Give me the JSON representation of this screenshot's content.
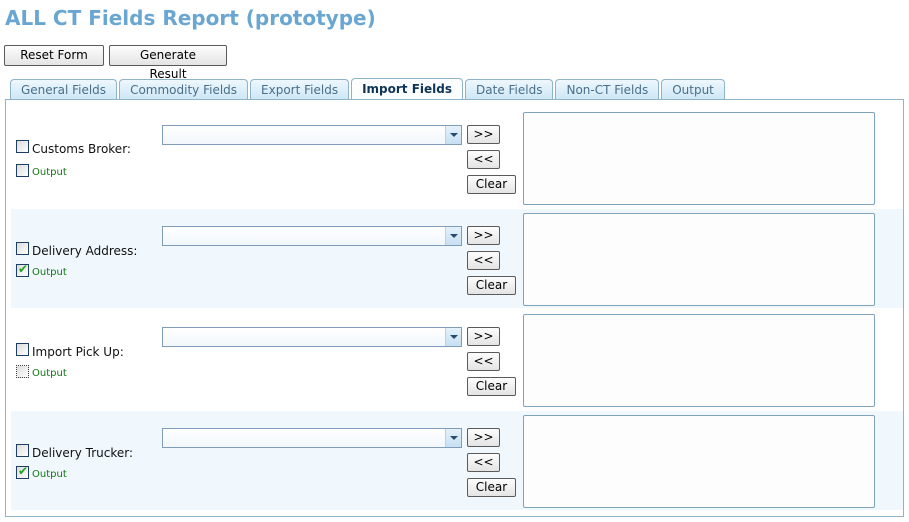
{
  "page": {
    "title": "ALL CT Fields Report (prototype)"
  },
  "toolbar": {
    "reset_label": "Reset Form",
    "generate_label": "Generate Result"
  },
  "tabs": [
    {
      "label": "General Fields",
      "active": false
    },
    {
      "label": "Commodity Fields",
      "active": false
    },
    {
      "label": "Export Fields",
      "active": false
    },
    {
      "label": "Import Fields",
      "active": true
    },
    {
      "label": "Date Fields",
      "active": false
    },
    {
      "label": "Non-CT Fields",
      "active": false
    },
    {
      "label": "Output",
      "active": false
    }
  ],
  "fields": [
    {
      "label": "Customs Broker:",
      "checked": false,
      "output_label": "Output",
      "output_checked": false,
      "select_value": "",
      "add_label": ">>",
      "remove_label": "<<",
      "clear_label": "Clear"
    },
    {
      "label": "Delivery Address:",
      "checked": false,
      "output_label": "Output",
      "output_checked": true,
      "select_value": "",
      "add_label": ">>",
      "remove_label": "<<",
      "clear_label": "Clear"
    },
    {
      "label": "Import Pick Up:",
      "checked": false,
      "output_label": "Output",
      "output_checked": false,
      "output_focused": true,
      "select_value": "",
      "add_label": ">>",
      "remove_label": "<<",
      "clear_label": "Clear"
    },
    {
      "label": "Delivery Trucker:",
      "checked": false,
      "output_label": "Output",
      "output_checked": true,
      "select_value": "",
      "add_label": ">>",
      "remove_label": "<<",
      "clear_label": "Clear"
    }
  ],
  "icons": {
    "checkmark": "✔",
    "dropdown": "chevron-down"
  }
}
